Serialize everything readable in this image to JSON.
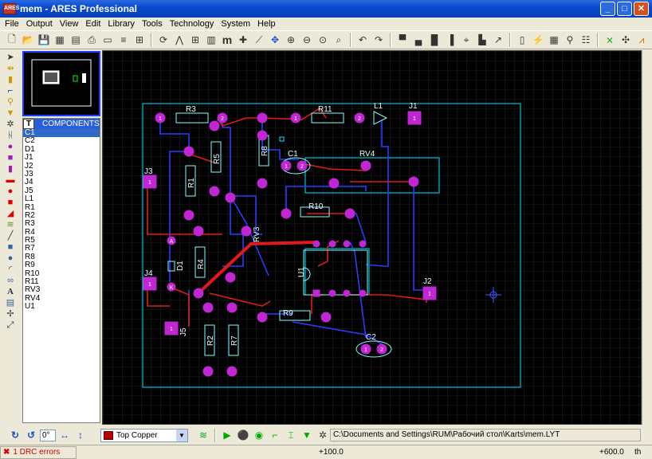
{
  "window": {
    "title": "mem - ARES Professional",
    "icon_text": "ARES",
    "minimize": "_",
    "maximize": "□",
    "close": "✕"
  },
  "menu": [
    {
      "label": "File"
    },
    {
      "label": "Output"
    },
    {
      "label": "View"
    },
    {
      "label": "Edit"
    },
    {
      "label": "Library"
    },
    {
      "label": "Tools"
    },
    {
      "label": "Technology"
    },
    {
      "label": "System"
    },
    {
      "label": "Help"
    }
  ],
  "components": {
    "header_t": "T",
    "title": "COMPONENTS",
    "items": [
      "C1",
      "C2",
      "D1",
      "J1",
      "J2",
      "J3",
      "J4",
      "J5",
      "L1",
      "R1",
      "R2",
      "R3",
      "R4",
      "R5",
      "R7",
      "R8",
      "R9",
      "R10",
      "R11",
      "RV3",
      "RV4",
      "U1"
    ],
    "selected": "C1"
  },
  "pcb": {
    "labels": {
      "R3": "R3",
      "R11": "R11",
      "L1": "L1",
      "J1": "J1",
      "C1": "C1",
      "RV4": "RV4",
      "J3": "J3",
      "R1": "R1",
      "R5": "R5",
      "R8": "R8",
      "R10": "R10",
      "RV3": "RV3",
      "D1": "D1",
      "R4": "R4",
      "U1": "U1",
      "J4": "J4",
      "J2": "J2",
      "R9": "R9",
      "J5": "J5",
      "R2": "R2",
      "R7": "R7",
      "C2": "C2"
    },
    "pad_texts": {
      "one": "1",
      "two": "2",
      "anode": "A",
      "cathode": "K"
    },
    "colors": {
      "board": "#00e5ff",
      "copper_top": "#e01a1a",
      "copper_bottom": "#2b3cff",
      "pad": "#c026d3",
      "silk": "#7fffff",
      "grid": "#2a2a2a"
    }
  },
  "bottom": {
    "rotation_value": "0°",
    "layer": "Top Copper",
    "file_path": "C:\\Documents and Settings\\RUM\\Рабочий стол\\Karts\\mem.LYT"
  },
  "status": {
    "drc": "1 DRC errors",
    "x": "+100.0",
    "y": "+600.0",
    "unit": "th"
  }
}
